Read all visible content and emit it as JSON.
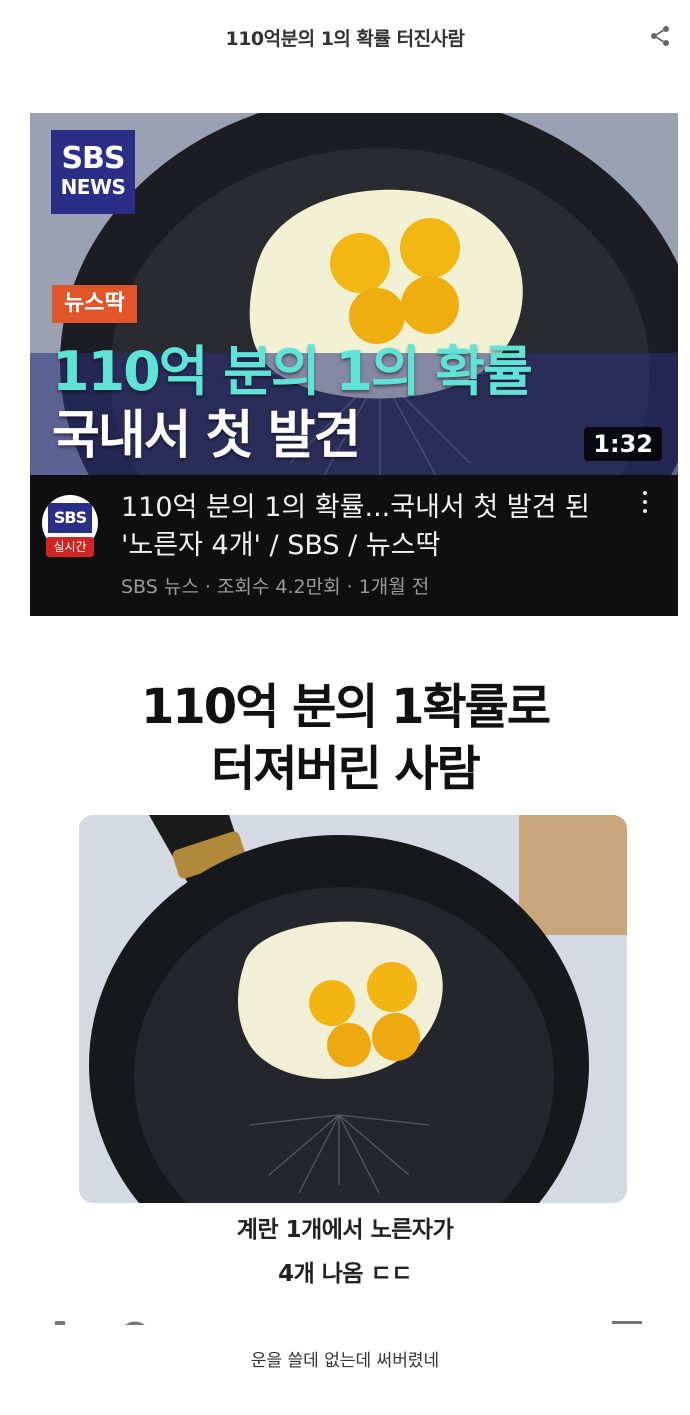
{
  "header": {
    "title": "110억분의 1의 확률 터진사람"
  },
  "video": {
    "logo_line1": "SBS",
    "logo_line2": "NEWS",
    "tag": "뉴스딱",
    "headline_line1": "110억 분의 1의 확률",
    "headline_line2": "국내서 첫 발견",
    "duration": "1:32",
    "channel_avatar_text": "SBS",
    "live_badge": "실시간",
    "title": "110억 분의 1의 확률...국내서 첫 발견 된 '노른자 4개' / SBS / 뉴스딱",
    "subtitle": "SBS 뉴스 · 조회수 4.2만회 · 1개월 전"
  },
  "meme": {
    "heading_line1": "110억 분의 1확률로",
    "heading_line2": "터져버린 사람",
    "caption_line1": "계란 1개에서 노른자가",
    "caption_line2": "4개 나옴 ㄷㄷ"
  },
  "footer": {
    "text": "운을 쓸데 없는데 써버렸네"
  },
  "colors": {
    "sbs_blue": "#2b2e86",
    "tag_orange": "#e0552a",
    "headline_cyan": "#5fe3d6",
    "live_red": "#d32424"
  },
  "icons": {
    "share": "share-icon",
    "more": "kebab-menu-icon"
  }
}
